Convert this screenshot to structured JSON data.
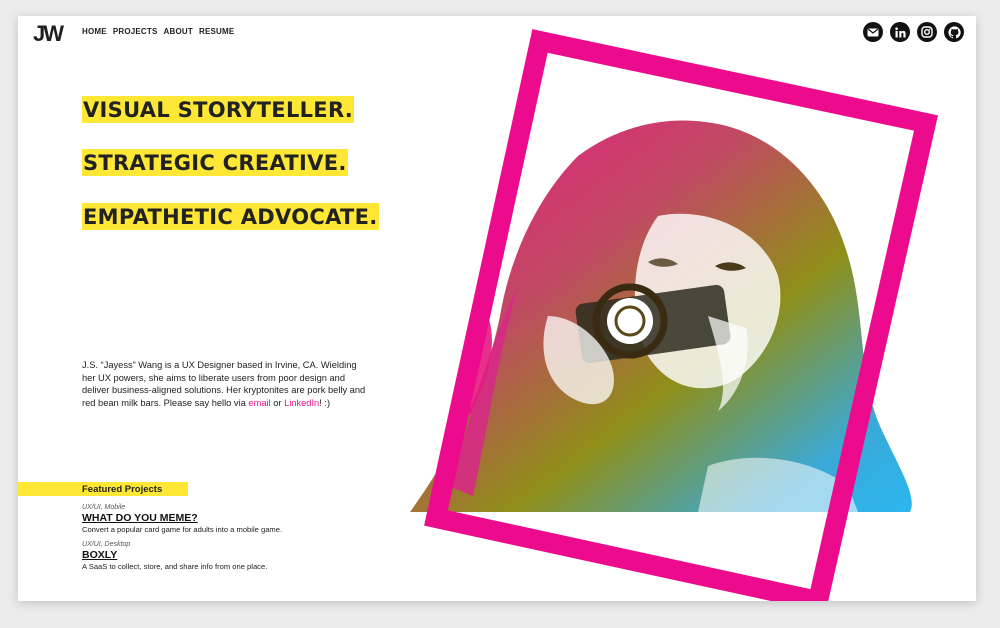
{
  "brand": {
    "logo": "JW"
  },
  "nav": {
    "items": [
      "HOME",
      "PROJECTS",
      "ABOUT",
      "RESUME"
    ]
  },
  "social": [
    "email-icon",
    "linkedin-icon",
    "instagram-icon",
    "github-icon"
  ],
  "hero": {
    "lines": [
      "VISUAL STORYTELLER.",
      "STRATEGIC CREATIVE.",
      "EMPATHETIC ADVOCATE."
    ]
  },
  "bio": {
    "text": "J.S. “Jayess” Wang is a UX Designer based in Irvine, CA. Wielding her UX powers, she aims to liberate users from poor design and deliver business-aligned solutions. Her kryptonites are pork belly and red bean milk bars. Please say hello via ",
    "email_link": "email",
    "joiner": " or ",
    "linkedin_link": "LinkedIn",
    "ending": "! :)"
  },
  "featured": {
    "heading": "Featured Projects",
    "projects": [
      {
        "category": "UX/UI, Mobile",
        "title": "WHAT DO YOU MEME?",
        "description": "Convert a popular card game for adults into a mobile game."
      },
      {
        "category": "UX/UI, Desktop",
        "title": "BOXLY",
        "description": "A SaaS to collect, store, and share info from one place."
      }
    ]
  },
  "colors": {
    "highlight": "#ffe835",
    "accent": "#e6178e",
    "text": "#1f1f1f"
  }
}
